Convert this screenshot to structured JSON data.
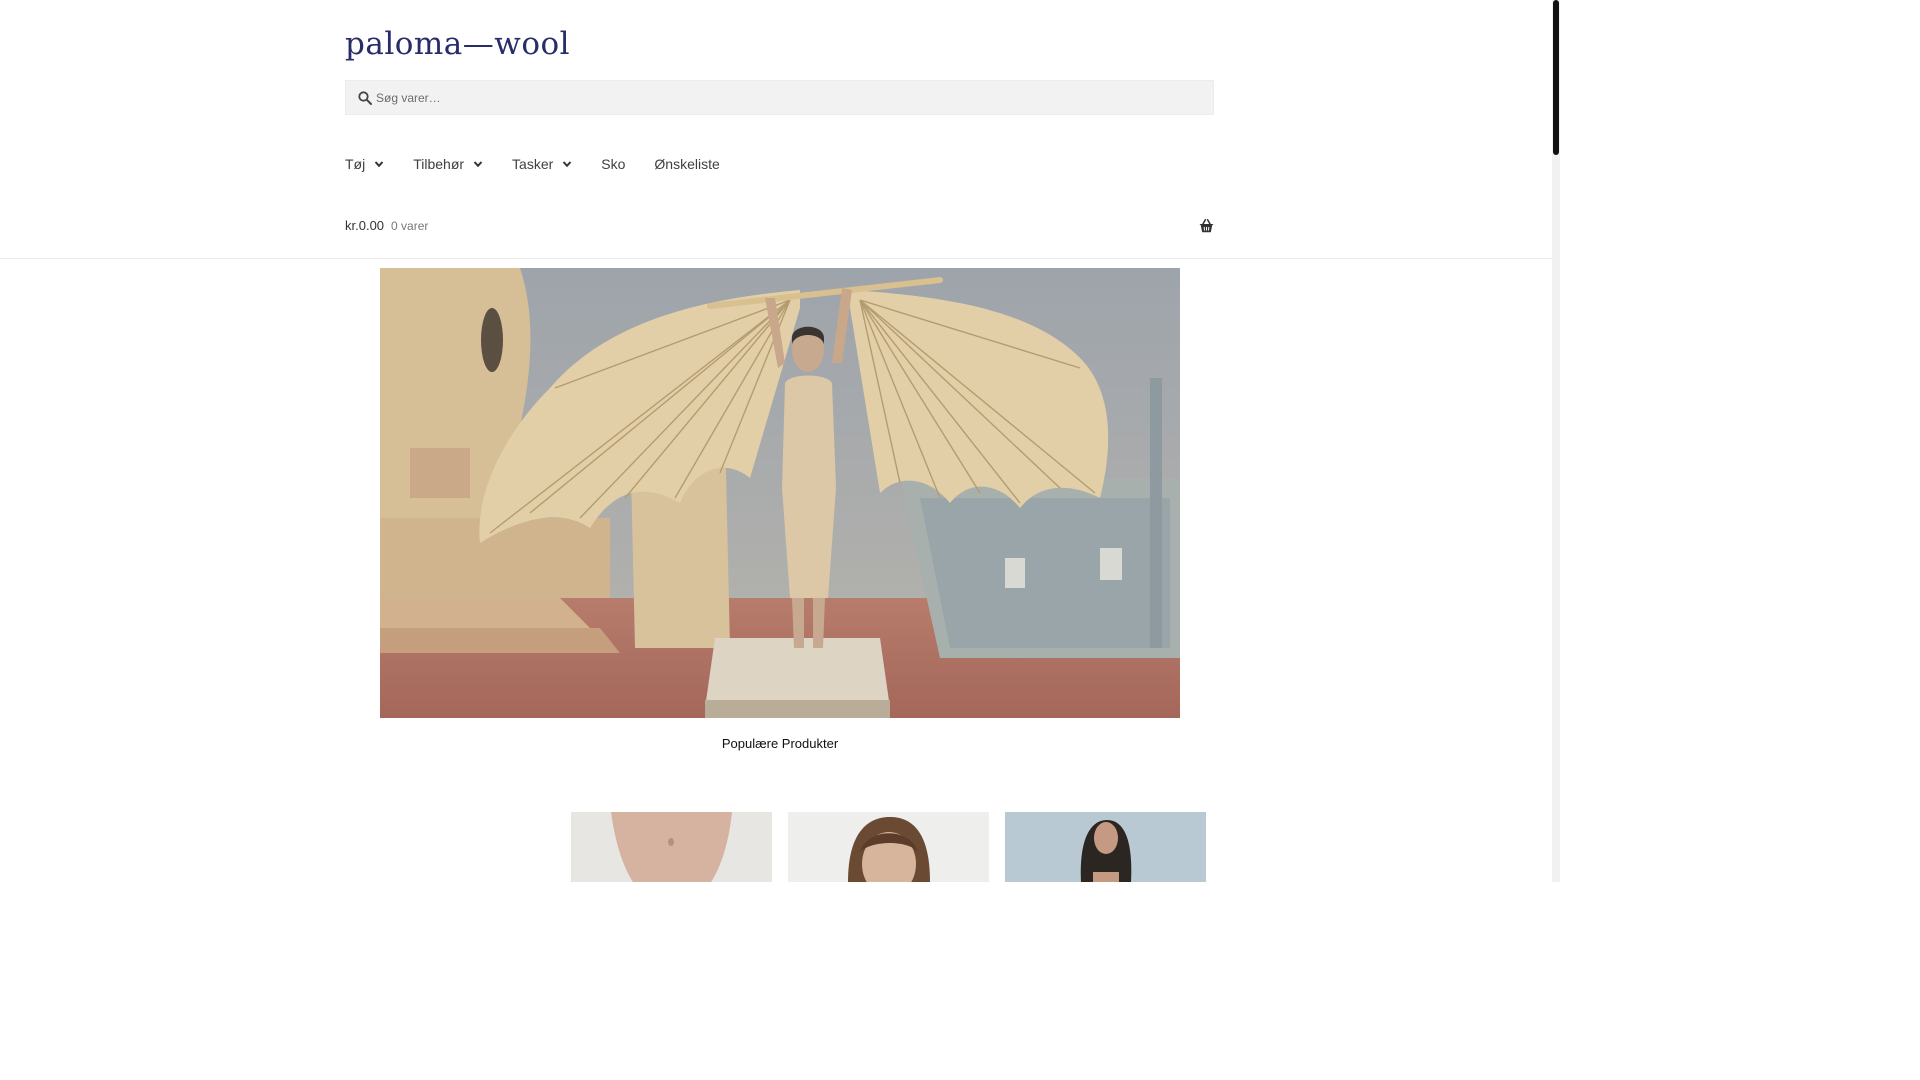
{
  "brand": {
    "logo_text": "paloma—wool",
    "logo_color": "#272d68"
  },
  "search": {
    "placeholder": "Søg varer…",
    "value": "",
    "icon": "search-icon"
  },
  "nav": {
    "items": [
      {
        "label": "Tøj",
        "has_dropdown": true
      },
      {
        "label": "Tilbehør",
        "has_dropdown": true
      },
      {
        "label": "Tasker",
        "has_dropdown": true
      },
      {
        "label": "Sko",
        "has_dropdown": false
      },
      {
        "label": "Ønskeliste",
        "has_dropdown": false
      }
    ]
  },
  "cart": {
    "amount": "kr.0.00",
    "count": "0 varer",
    "icon": "basket-icon"
  },
  "hero": {
    "image": "hero-image"
  },
  "sections": {
    "popular_title": "Populære Produkter"
  },
  "products": [
    {
      "image": "product-thumb-1"
    },
    {
      "image": "product-thumb-2"
    },
    {
      "image": "product-thumb-3"
    }
  ],
  "colors": {
    "accent": "#272d68",
    "text": "#404040",
    "search_bg": "#f2f2f2"
  }
}
